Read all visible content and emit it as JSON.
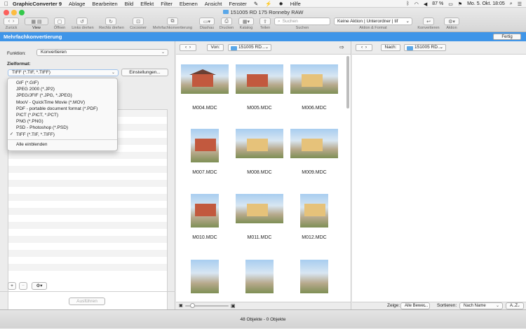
{
  "menubar": {
    "app": "GraphicConverter 9",
    "items": [
      "Ablage",
      "Bearbeiten",
      "Bild",
      "Effekt",
      "Filter",
      "Ebenen",
      "Ansicht",
      "Fenster",
      "Hilfe"
    ],
    "battery": "87 %",
    "clock": "Mo. 5. Okt.  18:05"
  },
  "window": {
    "title": "151005 RD 175 Ronneby RAW"
  },
  "toolbar": {
    "labels": {
      "back": "Zurück",
      "view": "View",
      "open": "Öffnen",
      "rotate_left": "Links drehen",
      "rotate_right": "Rechts drehen",
      "cocoon": "Cocooner",
      "batch": "Mehrfachkonvertierung",
      "slideshow": "Diashau",
      "print": "Drucken",
      "catalog": "Katalog",
      "share": "Teilen",
      "search": "Suchen",
      "action_format": "Aktion & Format",
      "convert": "Konvertieren",
      "action": "Aktion"
    },
    "search_placeholder": "Suchen",
    "action_select": "Keine Aktion | Unterordner | tif"
  },
  "bluebar": {
    "title": "Mehrfachkonvertierung",
    "done": "Fertig"
  },
  "left": {
    "function_label": "Funktion:",
    "function_value": "Konvertieren",
    "target_label": "Zielformat:",
    "target_value": "TIFF (*.TIF, *.TIFF)",
    "settings_button": "Einstellungen...",
    "run_button": "Ausführen",
    "popup": {
      "options": [
        "GIF (*.GIF)",
        "JPEG 2000 (*.JP2)",
        "JPEG/JFIF (*.JPG, *.JPEG)",
        "MooV - QuickTime Movie (*.MOV)",
        "PDF - portable document format (*.PDF)",
        "PICT (*.PICT, *.PCT)",
        "PNG (*.PNG)",
        "PSD - Photoshop (*.PSD)",
        "TIFF (*.TIF, *.TIFF)"
      ],
      "checked_mark": "✓",
      "show_all": "Alle einblenden"
    }
  },
  "middle": {
    "from_label": "Von:",
    "folder": "151005 RD...",
    "thumbnails": [
      {
        "name": "M004.MDC"
      },
      {
        "name": "M005.MDC"
      },
      {
        "name": "M006.MDC"
      },
      {
        "name": "M007.MDC"
      },
      {
        "name": "M008.MDC"
      },
      {
        "name": "M009.MDC"
      },
      {
        "name": "M010.MDC"
      },
      {
        "name": "M011.MDC"
      },
      {
        "name": "M012.MDC"
      },
      {
        "name": ""
      },
      {
        "name": ""
      },
      {
        "name": ""
      }
    ],
    "raw_badge": "RAW"
  },
  "right": {
    "to_label": "Nach:",
    "folder": "151005 RD...",
    "show_label": "Zeige:",
    "show_value": "Alle Bewer...",
    "sort_label": "Sortieren:",
    "sort_value": "Nach Name",
    "order_value": "A..Z"
  },
  "status": {
    "text": "48 Objekte - 0 Objekte"
  }
}
